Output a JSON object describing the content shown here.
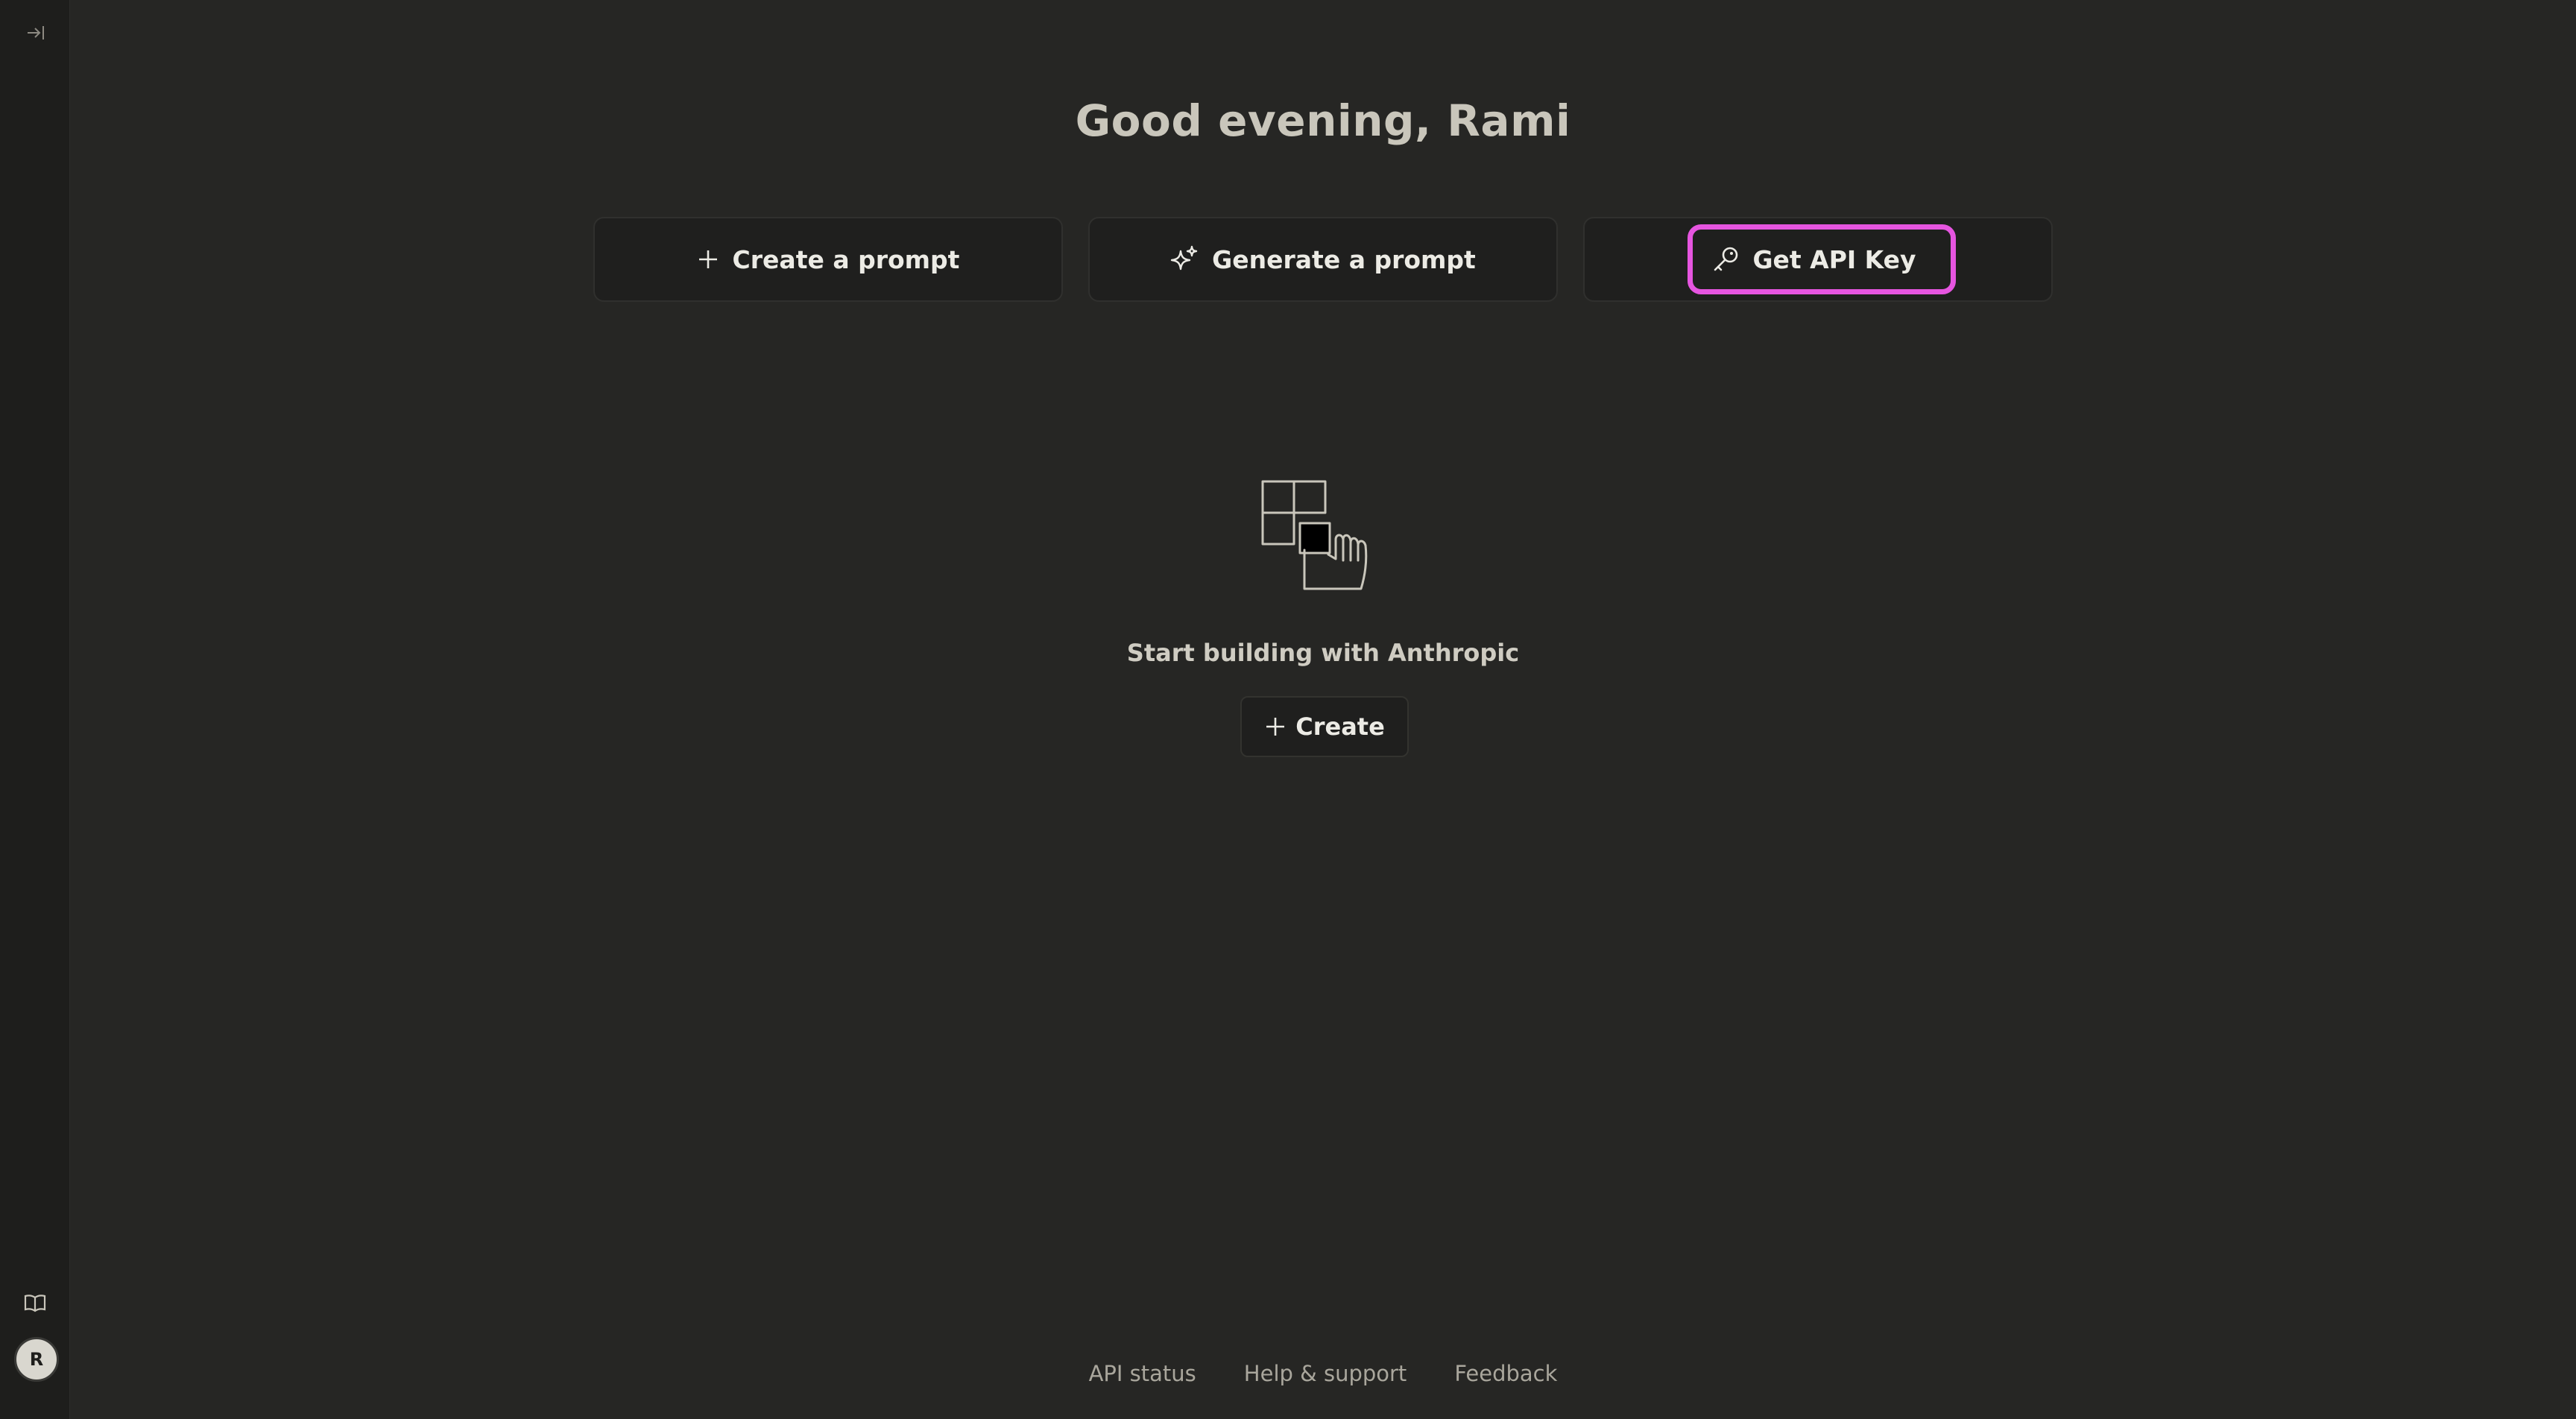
{
  "sidebar": {
    "expand_icon": "sidebar-expand-icon",
    "docs_icon": "book-icon",
    "avatar_initial": "R"
  },
  "header": {
    "greeting": "Good evening, Rami"
  },
  "actions": [
    {
      "label": "Create a prompt",
      "icon": "plus-icon"
    },
    {
      "label": "Generate a prompt",
      "icon": "sparkle-icon"
    },
    {
      "label": "Get API Key",
      "icon": "key-icon",
      "highlighted": true
    }
  ],
  "empty_state": {
    "title": "Start building with Anthropic",
    "create_label": "Create",
    "illustration": "hand-grabbing-block-illustration"
  },
  "footer": {
    "links": [
      "API status",
      "Help & support",
      "Feedback"
    ]
  },
  "colors": {
    "background": "#262624",
    "sidebar": "#1e1e1c",
    "highlight": "#e655e0"
  }
}
